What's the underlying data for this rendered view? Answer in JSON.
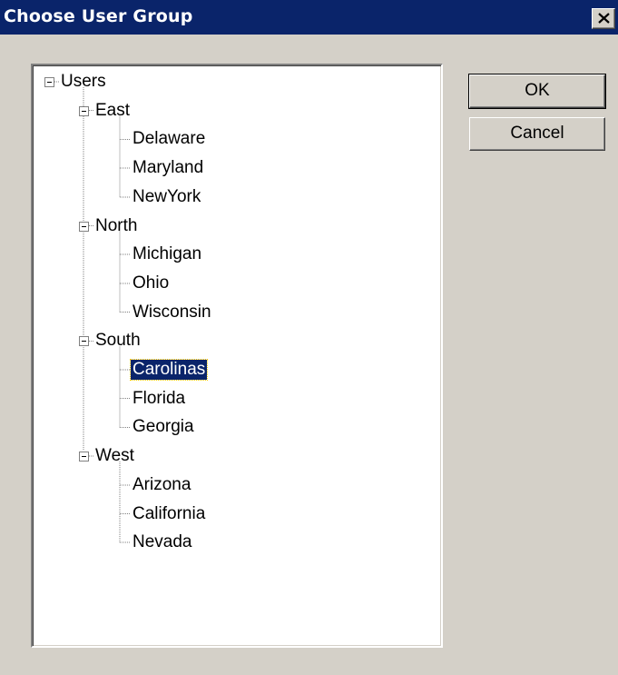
{
  "window": {
    "title": "Choose User Group"
  },
  "buttons": {
    "ok_label": "OK",
    "cancel_label": "Cancel"
  },
  "tree": {
    "root": "Users",
    "groups": [
      {
        "label": "East",
        "children": [
          "Delaware",
          "Maryland",
          "NewYork"
        ]
      },
      {
        "label": "North",
        "children": [
          "Michigan",
          "Ohio",
          "Wisconsin"
        ]
      },
      {
        "label": "South",
        "children": [
          "Carolinas",
          "Florida",
          "Georgia"
        ]
      },
      {
        "label": "West",
        "children": [
          "Arizona",
          "California",
          "Nevada"
        ]
      }
    ],
    "selected": "Carolinas"
  },
  "icons": {
    "close": "close-icon",
    "expander": "collapse-minus-icon"
  },
  "colors": {
    "titlebar": "#0a246a",
    "dialog_bg": "#d4d0c8",
    "selection_bg": "#0a246a",
    "selection_text": "#ffffff"
  }
}
